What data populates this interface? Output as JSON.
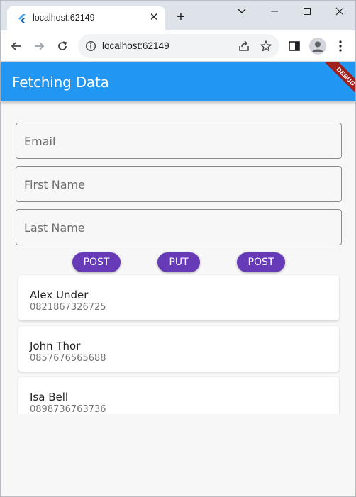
{
  "browser": {
    "tab_title": "localhost:62149",
    "tab_close": "✕",
    "new_tab": "+",
    "url": "localhost:62149"
  },
  "app": {
    "title": "Fetching Data",
    "debug_banner": "DEBUG",
    "primary_color": "#2196f3",
    "button_color": "#673ab7"
  },
  "form": {
    "email_placeholder": "Email",
    "first_name_placeholder": "First Name",
    "last_name_placeholder": "Last Name"
  },
  "actions": [
    "POST",
    "PUT",
    "POST"
  ],
  "users": [
    {
      "name": "Alex Under",
      "phone": "0821867326725"
    },
    {
      "name": "John Thor",
      "phone": "0857676565688"
    },
    {
      "name": "Isa Bell",
      "phone": "0898736763736"
    }
  ]
}
